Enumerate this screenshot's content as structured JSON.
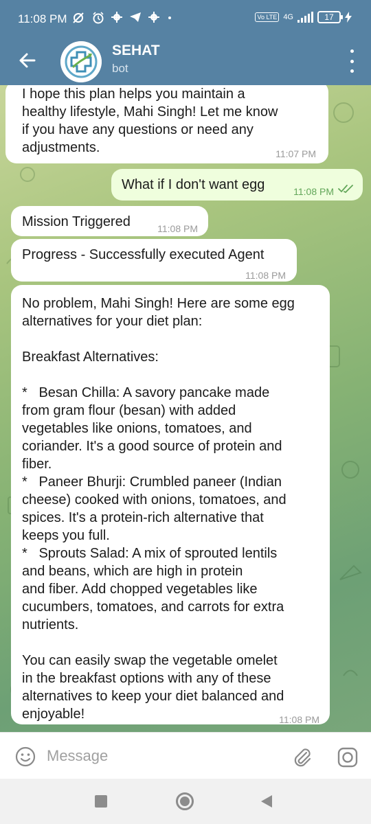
{
  "status_bar": {
    "time": "11:08 PM",
    "left_icons": [
      "data-saver-icon",
      "alarm-icon",
      "gear-icon",
      "telegram-icon",
      "gear-icon",
      "dot-icon"
    ],
    "volte_label": "Vo LTE",
    "network_label": "4G",
    "battery": "17"
  },
  "header": {
    "title": "SEHAT",
    "subtitle": "bot"
  },
  "messages": [
    {
      "direction": "incoming",
      "text": "I hope this plan helps you maintain a\nhealthy lifestyle, Mahi Singh! Let me know\nif you have any questions or need any\nadjustments.",
      "time": "11:07 PM"
    },
    {
      "direction": "outgoing",
      "text": "What if I don't want egg",
      "time": "11:08 PM",
      "read": true
    },
    {
      "direction": "incoming",
      "text": "Mission Triggered",
      "time": "11:08 PM"
    },
    {
      "direction": "incoming",
      "text": "Progress - Successfully executed Agent",
      "time": "11:08 PM"
    },
    {
      "direction": "incoming",
      "text": "No problem, Mahi Singh! Here are some egg\nalternatives for your diet plan:\n\nBreakfast Alternatives:\n\n*   Besan Chilla: A savory pancake made\nfrom gram flour (besan) with added\nvegetables like onions, tomatoes, and\ncoriander. It's a good source of protein and\nfiber.\n*   Paneer Bhurji: Crumbled paneer (Indian\ncheese) cooked with onions, tomatoes, and\nspices. It's a protein-rich alternative that\nkeeps you full.\n*   Sprouts Salad: A mix of sprouted lentils\nand beans, which are high in protein\nand fiber. Add chopped vegetables like\ncucumbers, tomatoes, and carrots for extra\nnutrients.\n\nYou can easily swap the vegetable omelet\nin the breakfast options with any of these\nalternatives to keep your diet balanced and\nenjoyable!",
      "time": "11:08 PM"
    }
  ],
  "composer": {
    "placeholder": "Message",
    "value": ""
  },
  "colors": {
    "header": "#5682a3",
    "outgoing_bubble": "#effedd",
    "incoming_bubble": "#ffffff",
    "outgoing_time": "#62a659"
  }
}
